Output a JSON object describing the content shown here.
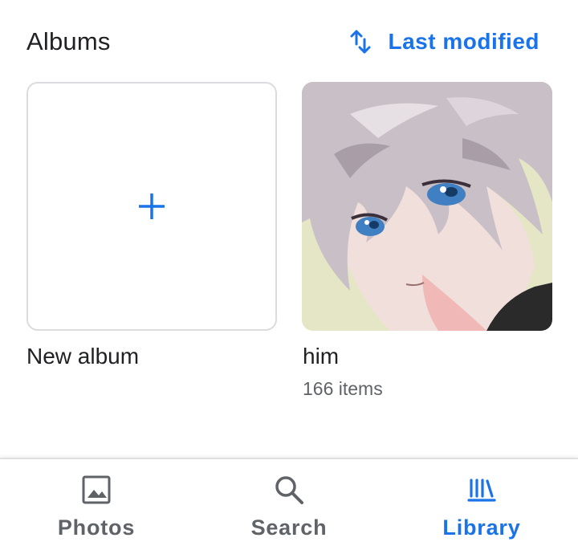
{
  "albums_section": {
    "title": "Albums",
    "sort_label": "Last modified",
    "sort_icon": "swap-vert-icon"
  },
  "new_album": {
    "label": "New album",
    "icon": "plus-icon"
  },
  "albums": [
    {
      "name": "him",
      "count": "166 items"
    }
  ],
  "bottom_nav": {
    "items": [
      {
        "label": "Photos",
        "icon": "photo-icon",
        "active": false
      },
      {
        "label": "Search",
        "icon": "search-icon",
        "active": false
      },
      {
        "label": "Library",
        "icon": "library-icon",
        "active": true
      }
    ]
  },
  "colors": {
    "accent": "#1a73e8",
    "text_primary": "#202124",
    "text_secondary": "#5f6368",
    "tile_border": "#dadce0"
  }
}
